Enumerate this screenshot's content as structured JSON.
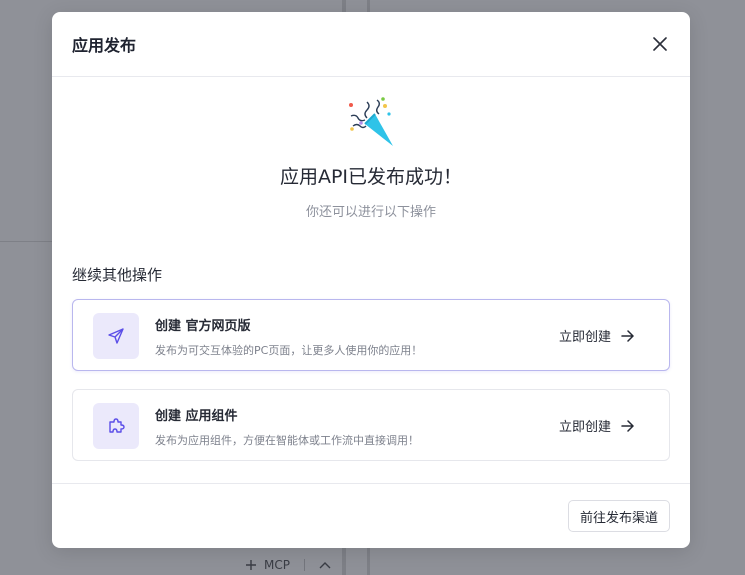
{
  "background": {
    "bottom_bar": {
      "mcp_label": "MCP",
      "add_icon": "plus-icon",
      "collapse_icon": "chevron-up-icon"
    }
  },
  "modal": {
    "title": "应用发布",
    "close_icon": "close-icon",
    "hero": {
      "icon": "party-popper-icon",
      "title": "应用API已发布成功！",
      "subtitle": "你还可以进行以下操作"
    },
    "section_title": "继续其他操作",
    "cards": [
      {
        "icon": "send-icon",
        "title": "创建 官方网页版",
        "description": "发布为可交互体验的PC页面，让更多人使用你的应用！",
        "action_label": "立即创建",
        "action_icon": "arrow-right-icon"
      },
      {
        "icon": "puzzle-icon",
        "title": "创建 应用组件",
        "description": "发布为应用组件，方便在智能体或工作流中直接调用！",
        "action_label": "立即创建",
        "action_icon": "arrow-right-icon"
      }
    ],
    "footer_button": "前往发布渠道"
  },
  "colors": {
    "overlay": "#8f9198",
    "accent": "#5b4ee8",
    "accent_light": "#ebe9fb",
    "popper": "#2fc3e8"
  }
}
